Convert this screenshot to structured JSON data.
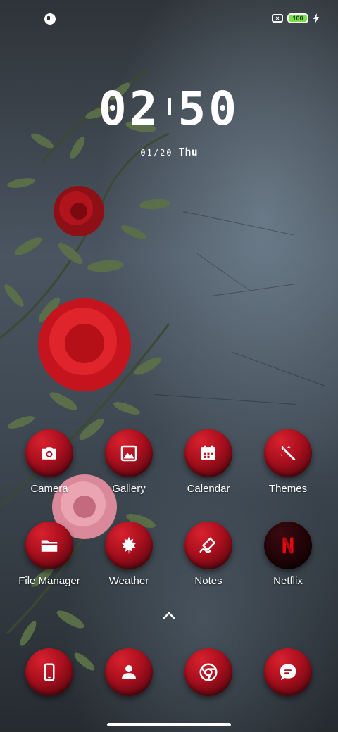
{
  "status_bar": {
    "left_icon": "notification-dot-icon",
    "sim_icon": "no-sim-icon",
    "battery_level": "100",
    "charging_icon": "bolt-icon",
    "battery_color": "#7ae04a"
  },
  "clock": {
    "hours": "02",
    "minutes": "50"
  },
  "date": {
    "date": "01/20",
    "weekday": "Thu"
  },
  "apps": [
    {
      "label": "Camera",
      "icon": "camera-icon"
    },
    {
      "label": "Gallery",
      "icon": "gallery-icon"
    },
    {
      "label": "Calendar",
      "icon": "calendar-icon"
    },
    {
      "label": "Themes",
      "icon": "magic-wand-icon"
    },
    {
      "label": "File Manager",
      "icon": "folder-icon"
    },
    {
      "label": "Weather",
      "icon": "leaf-icon"
    },
    {
      "label": "Notes",
      "icon": "pen-icon"
    },
    {
      "label": "Netflix",
      "icon": "netflix-icon"
    }
  ],
  "drawer": {
    "icon": "chevron-up-icon"
  },
  "dock": [
    {
      "icon": "phone-icon"
    },
    {
      "icon": "contacts-icon"
    },
    {
      "icon": "chrome-icon"
    },
    {
      "icon": "messages-icon"
    }
  ],
  "theme": {
    "icon_red": "#a80f1d"
  }
}
